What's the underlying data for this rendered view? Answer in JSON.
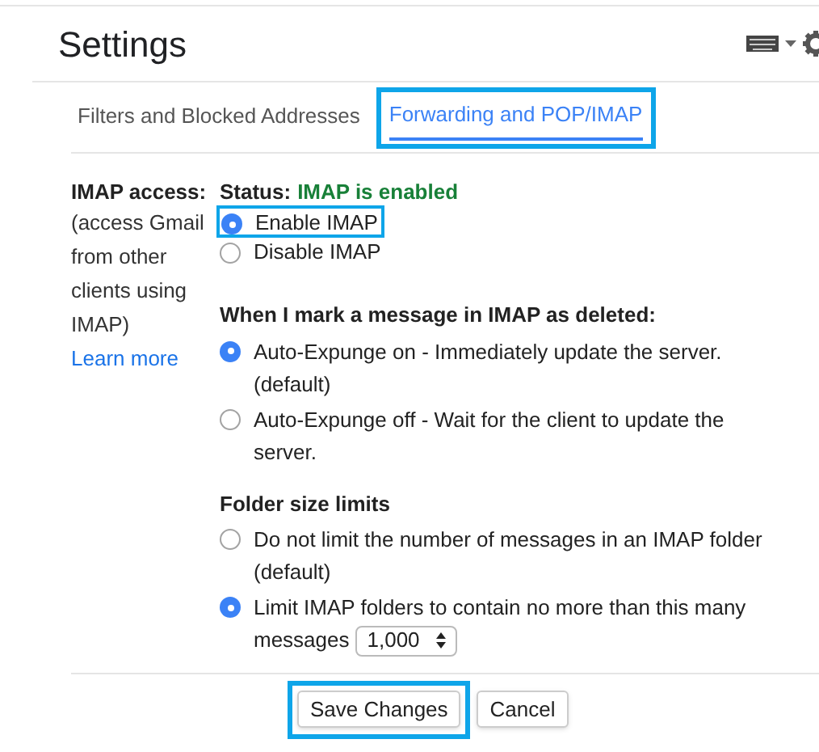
{
  "title": "Settings",
  "tabs": [
    {
      "label": "Filters and Blocked Addresses",
      "selected": false,
      "highlighted": false
    },
    {
      "label": "Forwarding and POP/IMAP",
      "selected": true,
      "highlighted": true
    }
  ],
  "imap": {
    "label": "IMAP access:",
    "status_label": "Status:",
    "status": "IMAP is enabled",
    "description": "(access Gmail from other clients using IMAP)",
    "link": "Learn more",
    "access_options": [
      {
        "label": "Enable IMAP",
        "selected": true,
        "highlighted": true
      },
      {
        "label": "Disable IMAP",
        "selected": false,
        "highlighted": false
      }
    ],
    "sections": [
      {
        "heading": "When I mark a message in IMAP as deleted:",
        "options": [
          {
            "label": "Auto-Expunge on - Immediately update the server. (default)",
            "selected": true
          },
          {
            "label": "Auto-Expunge off - Wait for the client to update the server.",
            "selected": false
          }
        ]
      },
      {
        "heading": "Folder size limits",
        "options": [
          {
            "label": "Do not limit the number of messages in an IMAP folder (default)",
            "selected": false
          },
          {
            "label": "Limit IMAP folders to contain no more than this many",
            "selected": true,
            "select_prefix": "messages",
            "select_value": "1,000"
          }
        ]
      }
    ]
  },
  "buttons": [
    {
      "label": "Save Changes",
      "highlighted": true
    },
    {
      "label": "Cancel",
      "highlighted": false
    }
  ]
}
